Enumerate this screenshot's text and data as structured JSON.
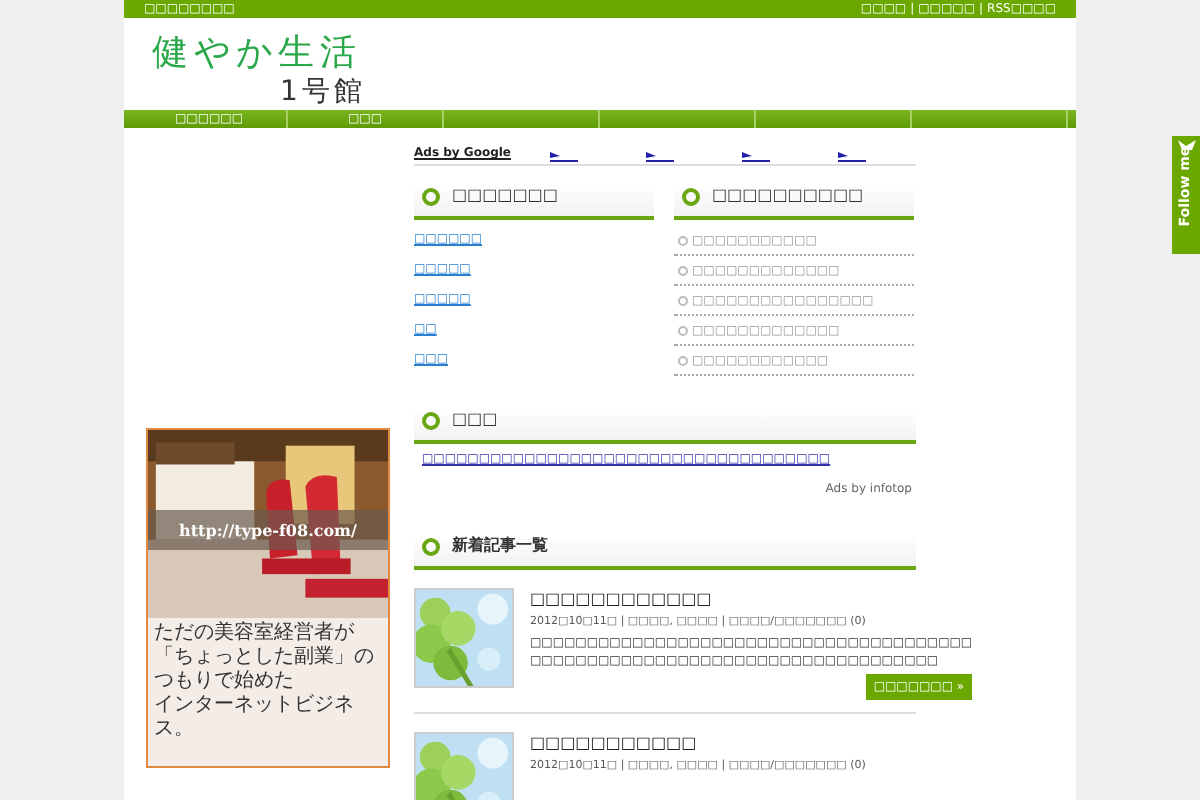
{
  "topbar": {
    "tagline": "□□□□□□□□",
    "links": [
      "□□□□",
      "□□□□□",
      "RSS□□□□"
    ],
    "separator": "|"
  },
  "site": {
    "title": "健やか生活",
    "subtitle": "1号館"
  },
  "nav": [
    "□□□□□□",
    "□□□"
  ],
  "ads": {
    "label": "Ads by Google",
    "links": [
      {
        "kind": "flag"
      },
      {
        "kind": "flag"
      },
      {
        "kind": "flag"
      },
      {
        "kind": "flag"
      }
    ]
  },
  "widgets": [
    {
      "title": "□□□□□□□",
      "kind": "links",
      "items": [
        "□□□□□□",
        "□□□□□",
        "□□□□□",
        "□□",
        "□□□"
      ]
    },
    {
      "title": "□□□□□□□□□□",
      "kind": "list",
      "items": [
        "□□□□□□□□□□□",
        "□□□□□□□□□□□□□",
        "□□□□□□□□□□□□□□□□",
        "□□□□□□□□□□□□□",
        "□□□□□□□□□□□□"
      ]
    }
  ],
  "pr": {
    "title": "□□□",
    "link": "□□□□□□□□□□□□□□□□□□□□□□□□□□□□□□□□□□□□",
    "credit": "Ads by infotop"
  },
  "latest": {
    "title": "新着記事一覧",
    "articles": [
      {
        "title": "□□□□□□□□□□□□",
        "meta": "2012□10□11□ | □□□□, □□□□ | □□□□/□□□□□□□ (0)",
        "excerpt": "□□□□□□□□□□□□□□□□□□□□□□□□□□□□□□□□□□□□□□□ □□□□□□□□□□□□□□□□□□□□□□□□□□□□□□□□□□□□",
        "more": "□□□□□□□ »"
      },
      {
        "title": "□□□□□□□□□□□",
        "meta": "2012□10□11□ | □□□□, □□□□ | □□□□/□□□□□□□ (0)"
      }
    ]
  },
  "banner": {
    "url": "http://type-f08.com/",
    "caption": [
      "ただの美容室経営者が",
      "「ちょっとした副業」のつもりで始めた",
      "インターネットビジネス。"
    ]
  },
  "follow": {
    "label": "Follow me"
  }
}
